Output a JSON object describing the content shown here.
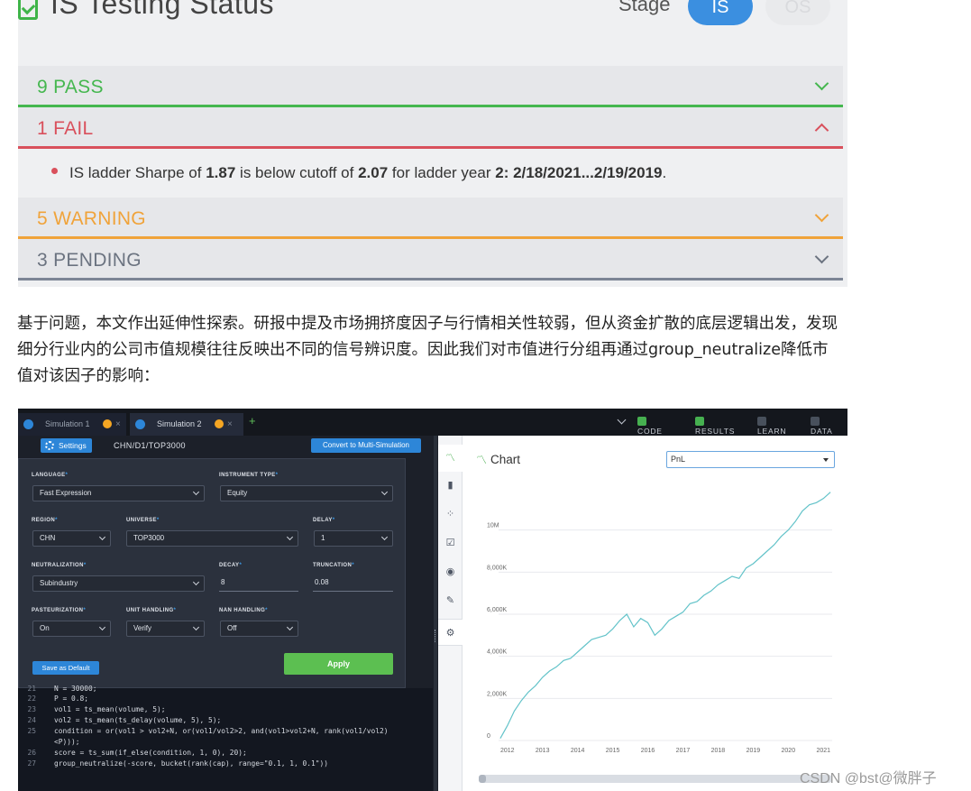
{
  "status": {
    "title": "IS Testing Status",
    "stage_label": "Stage",
    "stage_is": "IS",
    "stage_os": "OS",
    "pass": "9 PASS",
    "fail": "1 FAIL",
    "warning": "5 WARNING",
    "pending": "3 PENDING",
    "fail_detail": {
      "t1": "IS ladder Sharpe of ",
      "sharpe": "1.87",
      "t2": " is below cutoff of ",
      "cutoff": "2.07",
      "t3": " for ladder year ",
      "year": "2: 2/18/2021...2/19/2019",
      "t4": "."
    }
  },
  "article": {
    "paragraph": "基于问题，本文作出延伸性探索。研报中提及市场拥挤度因子与行情相关性较弱，但从资金扩散的底层逻辑出发，发现细分行业内的公司市值规模往往反映出不同的信号辨识度。因此我们对市值进行分组再通过group_neutralize降低市值对该因子的影响："
  },
  "sim": {
    "tabs": [
      {
        "label": "Simulation 1"
      },
      {
        "label": "Simulation 2"
      }
    ],
    "add_tab": "+",
    "close": "×",
    "toggles": {
      "code": "CODE",
      "results": "RESULTS",
      "learn": "LEARN",
      "data": "DATA"
    },
    "settings_label": "Settings",
    "path": "CHN/D1/TOP3000",
    "convert_label": "Convert to Multi-Simulation",
    "fields": {
      "language": {
        "label": "LANGUAGE",
        "value": "Fast Expression"
      },
      "instrument_type": {
        "label": "INSTRUMENT TYPE",
        "value": "Equity"
      },
      "region": {
        "label": "REGION",
        "value": "CHN"
      },
      "universe": {
        "label": "UNIVERSE",
        "value": "TOP3000"
      },
      "delay": {
        "label": "DELAY",
        "value": "1"
      },
      "neutralization": {
        "label": "NEUTRALIZATION",
        "value": "Subindustry"
      },
      "decay": {
        "label": "DECAY",
        "value": "8"
      },
      "truncation": {
        "label": "TRUNCATION",
        "value": "0.08"
      },
      "pasteurization": {
        "label": "PASTEURIZATION",
        "value": "On"
      },
      "unit_handling": {
        "label": "UNIT HANDLING",
        "value": "Verify"
      },
      "nan_handling": {
        "label": "NAN HANDLING",
        "value": "Off"
      }
    },
    "star": "*",
    "save_default_label": "Save as Default",
    "apply_label": "Apply",
    "code": [
      {
        "n": "21",
        "t": "N = 30000;"
      },
      {
        "n": "22",
        "t": "P = 0.8;"
      },
      {
        "n": "23",
        "t": "vol1 = ts_mean(volume, 5);"
      },
      {
        "n": "24",
        "t": "vol2 = ts_mean(ts_delay(volume, 5), 5);"
      },
      {
        "n": "25",
        "t": "condition = or(vol1 > vol2+N, or(vol1/vol2>2, and(vol1>vol2+N, rank(vol1/vol2)"
      },
      {
        "n": "",
        "t": "<P)));"
      },
      {
        "n": "26",
        "t": "score = ts_sum(if_else(condition, 1, 0), 20);"
      },
      {
        "n": "27",
        "t": "group_neutralize(-score, bucket(rank(cap), range=\"0.1, 1, 0.1\"))"
      }
    ],
    "chart_title": "Chart",
    "chart_select": "PnL"
  },
  "chart_data": {
    "type": "line",
    "title": "",
    "xlabel": "",
    "ylabel": "",
    "y_ticks": [
      "0",
      "2,000K",
      "4,000K",
      "6,000K",
      "8,000K",
      "10M"
    ],
    "x_ticks": [
      "2012",
      "2013",
      "2014",
      "2015",
      "2016",
      "2017",
      "2018",
      "2019",
      "2020",
      "2021"
    ],
    "ylim": [
      0,
      12000000
    ],
    "grid": true,
    "color": "#63c3c9",
    "series": [
      {
        "x": [
          2011.8,
          2012.0,
          2012.2,
          2012.4,
          2012.6,
          2012.8,
          2013.0,
          2013.2,
          2013.4,
          2013.6,
          2013.8,
          2014.0,
          2014.2,
          2014.4,
          2014.6,
          2014.8,
          2015.0,
          2015.2,
          2015.4,
          2015.6,
          2015.8,
          2016.0,
          2016.2,
          2016.4,
          2016.6,
          2016.8,
          2017.0,
          2017.2,
          2017.4,
          2017.6,
          2017.8,
          2018.0,
          2018.2,
          2018.4,
          2018.6,
          2018.8,
          2019.0,
          2019.2,
          2019.4,
          2019.6,
          2019.8,
          2020.0,
          2020.2,
          2020.4,
          2020.6,
          2020.8,
          2021.0,
          2021.2
        ],
        "values": [
          100000,
          700000,
          1400000,
          1900000,
          2300000,
          2600000,
          3000000,
          3300000,
          3500000,
          3800000,
          3900000,
          4200000,
          4500000,
          4800000,
          4900000,
          5000000,
          5300000,
          5700000,
          6000000,
          5400000,
          5800000,
          5600000,
          5000000,
          5300000,
          5700000,
          5900000,
          6100000,
          6500000,
          6600000,
          6900000,
          7100000,
          7400000,
          7600000,
          7800000,
          7700000,
          8200000,
          8400000,
          8700000,
          9000000,
          9300000,
          9700000,
          10000000,
          10400000,
          10900000,
          11200000,
          11300000,
          11500000,
          11800000
        ]
      }
    ]
  },
  "watermark": "CSDN @bst@微胖子"
}
